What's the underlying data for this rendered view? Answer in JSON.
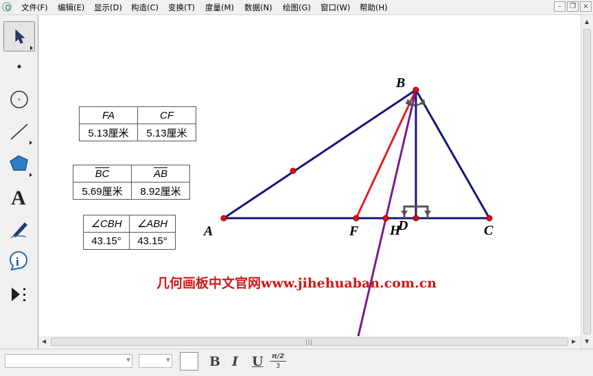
{
  "menu": {
    "items": [
      "文件(F)",
      "编辑(E)",
      "显示(D)",
      "构造(C)",
      "变换(T)",
      "度量(M)",
      "数据(N)",
      "绘图(G)",
      "窗口(W)",
      "帮助(H)"
    ],
    "window_controls": {
      "minimize": "–",
      "restore": "❐",
      "close": "×"
    }
  },
  "toolbox": {
    "tools": [
      {
        "name": "arrow-tool",
        "icon": "arrow-select-icon",
        "selected": true
      },
      {
        "name": "point-tool",
        "icon": "point-icon"
      },
      {
        "name": "compass-tool",
        "icon": "circle-compass-icon"
      },
      {
        "name": "straightedge-tool",
        "icon": "segment-icon"
      },
      {
        "name": "polygon-tool",
        "icon": "polygon-icon"
      },
      {
        "name": "text-tool",
        "icon": "text-A-icon",
        "glyph": "A"
      },
      {
        "name": "marker-tool",
        "icon": "marker-pen-icon"
      },
      {
        "name": "information-tool",
        "icon": "info-icon",
        "glyph": "i"
      },
      {
        "name": "custom-tool",
        "icon": "custom-tools-icon"
      }
    ]
  },
  "tables": {
    "segments": {
      "headers": [
        "FA",
        "CF"
      ],
      "values": [
        "5.13厘米",
        "5.13厘米"
      ]
    },
    "lengths": {
      "headers": [
        "BC",
        "AB"
      ],
      "values": [
        "5.69厘米",
        "8.92厘米"
      ]
    },
    "angles": {
      "headers": [
        "∠CBH",
        "∠ABH"
      ],
      "values": [
        "43.15°",
        "43.15°"
      ]
    }
  },
  "points": {
    "A": {
      "label": "A"
    },
    "B": {
      "label": "B"
    },
    "C": {
      "label": "C"
    },
    "F": {
      "label": "F"
    },
    "H": {
      "label": "H"
    },
    "D": {
      "label": "D"
    }
  },
  "watermark": "几何画板中文官网www.jihehuaban.com.cn",
  "format_bar": {
    "bold": "B",
    "italic": "I",
    "underline": "U",
    "symbol_top": "π/2",
    "symbol_bottom": "3"
  },
  "colors": {
    "triangle": "#14147a",
    "median": "#e02020",
    "bisector": "#7a1a8a",
    "point": "#e01010",
    "watermark": "#d01818"
  }
}
